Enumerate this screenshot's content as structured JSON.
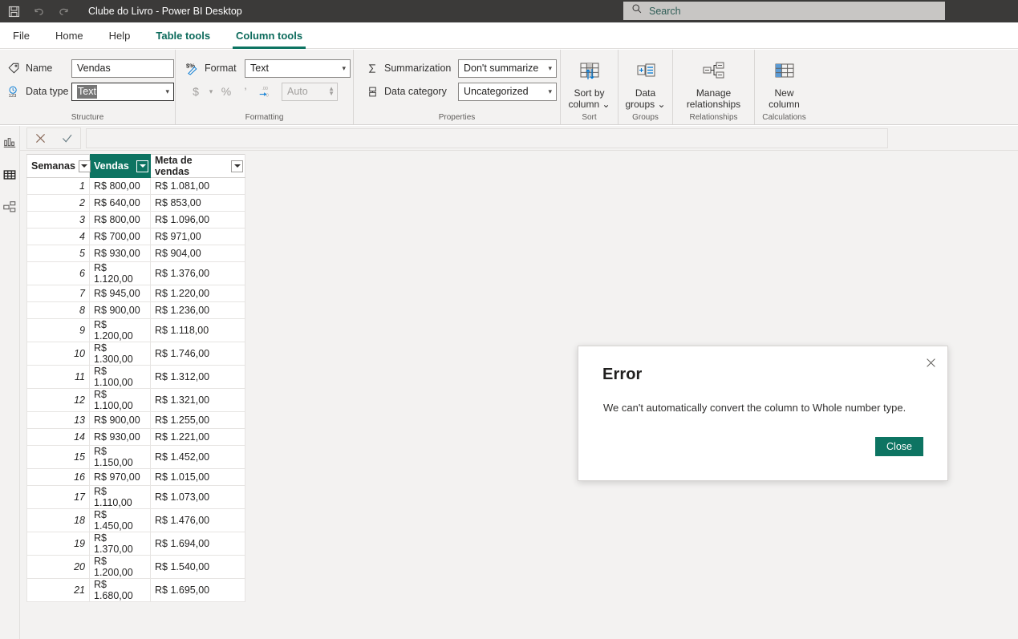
{
  "titlebar": {
    "icons": [
      "save-icon",
      "undo-icon",
      "redo-icon"
    ],
    "title": "Clube do Livro - Power BI Desktop",
    "search_placeholder": "Search",
    "search_value": "Search"
  },
  "tabs": [
    {
      "label": "File",
      "state": "normal"
    },
    {
      "label": "Home",
      "state": "normal"
    },
    {
      "label": "Help",
      "state": "normal"
    },
    {
      "label": "Table tools",
      "state": "accent"
    },
    {
      "label": "Column tools",
      "state": "active"
    }
  ],
  "ribbon": {
    "structure": {
      "group_label": "Structure",
      "name_label": "Name",
      "name_value": "Vendas",
      "datatype_label": "Data type",
      "datatype_value": "Text"
    },
    "formatting": {
      "group_label": "Formatting",
      "format_label": "Format",
      "format_value": "Text",
      "currency_symbol": "$",
      "percent_symbol": "%",
      "thousands_symbol": "’",
      "decimal_symbol": ".00",
      "decimal_places_value": "Auto"
    },
    "properties": {
      "group_label": "Properties",
      "summarization_label": "Summarization",
      "summarization_value": "Don't summarize",
      "datacategory_label": "Data category",
      "datacategory_value": "Uncategorized"
    },
    "sort": {
      "group_label": "Sort",
      "button_line1": "Sort by",
      "button_line2": "column ⌄"
    },
    "groups": {
      "group_label": "Groups",
      "button_line1": "Data",
      "button_line2": "groups ⌄"
    },
    "relationships": {
      "group_label": "Relationships",
      "button_line1": "Manage",
      "button_line2": "relationships"
    },
    "calculations": {
      "group_label": "Calculations",
      "button_line1": "New",
      "button_line2": "column"
    }
  },
  "viewbar": {
    "items": [
      {
        "icon": "report-view-icon",
        "selected": false
      },
      {
        "icon": "data-view-icon",
        "selected": true
      },
      {
        "icon": "model-view-icon",
        "selected": false
      }
    ]
  },
  "formula_bar": {
    "cancel_icon": "cancel-x-icon",
    "confirm_icon": "confirm-check-icon",
    "value": ""
  },
  "table": {
    "columns": [
      {
        "label": "Semanas",
        "selected": false
      },
      {
        "label": "Vendas",
        "selected": true
      },
      {
        "label": "Meta de vendas",
        "selected": false
      }
    ],
    "rows": [
      {
        "semanas": "1",
        "vendas": "R$ 800,00",
        "meta": "R$ 1.081,00"
      },
      {
        "semanas": "2",
        "vendas": "R$ 640,00",
        "meta": "R$ 853,00"
      },
      {
        "semanas": "3",
        "vendas": "R$ 800,00",
        "meta": "R$ 1.096,00"
      },
      {
        "semanas": "4",
        "vendas": "R$ 700,00",
        "meta": "R$ 971,00"
      },
      {
        "semanas": "5",
        "vendas": "R$ 930,00",
        "meta": "R$ 904,00"
      },
      {
        "semanas": "6",
        "vendas": "R$ 1.120,00",
        "meta": "R$ 1.376,00"
      },
      {
        "semanas": "7",
        "vendas": "R$ 945,00",
        "meta": "R$ 1.220,00"
      },
      {
        "semanas": "8",
        "vendas": "R$ 900,00",
        "meta": "R$ 1.236,00"
      },
      {
        "semanas": "9",
        "vendas": "R$ 1.200,00",
        "meta": "R$ 1.118,00"
      },
      {
        "semanas": "10",
        "vendas": "R$ 1.300,00",
        "meta": "R$ 1.746,00"
      },
      {
        "semanas": "11",
        "vendas": "R$ 1.100,00",
        "meta": "R$ 1.312,00"
      },
      {
        "semanas": "12",
        "vendas": "R$ 1.100,00",
        "meta": "R$ 1.321,00"
      },
      {
        "semanas": "13",
        "vendas": "R$ 900,00",
        "meta": "R$ 1.255,00"
      },
      {
        "semanas": "14",
        "vendas": "R$ 930,00",
        "meta": "R$ 1.221,00"
      },
      {
        "semanas": "15",
        "vendas": "R$ 1.150,00",
        "meta": "R$ 1.452,00"
      },
      {
        "semanas": "16",
        "vendas": "R$ 970,00",
        "meta": "R$ 1.015,00"
      },
      {
        "semanas": "17",
        "vendas": "R$ 1.110,00",
        "meta": "R$ 1.073,00"
      },
      {
        "semanas": "18",
        "vendas": "R$ 1.450,00",
        "meta": "R$ 1.476,00"
      },
      {
        "semanas": "19",
        "vendas": "R$ 1.370,00",
        "meta": "R$ 1.694,00"
      },
      {
        "semanas": "20",
        "vendas": "R$ 1.200,00",
        "meta": "R$ 1.540,00"
      },
      {
        "semanas": "21",
        "vendas": "R$ 1.680,00",
        "meta": "R$ 1.695,00"
      }
    ]
  },
  "dialog": {
    "title": "Error",
    "message": "We can't automatically convert the column to Whole number type.",
    "close_button": "Close",
    "close_icon": "close-x-icon"
  },
  "colors": {
    "accent": "#0d7462",
    "titlebar_bg": "#3b3a39",
    "ribbon_bg": "#f3f2f1"
  }
}
